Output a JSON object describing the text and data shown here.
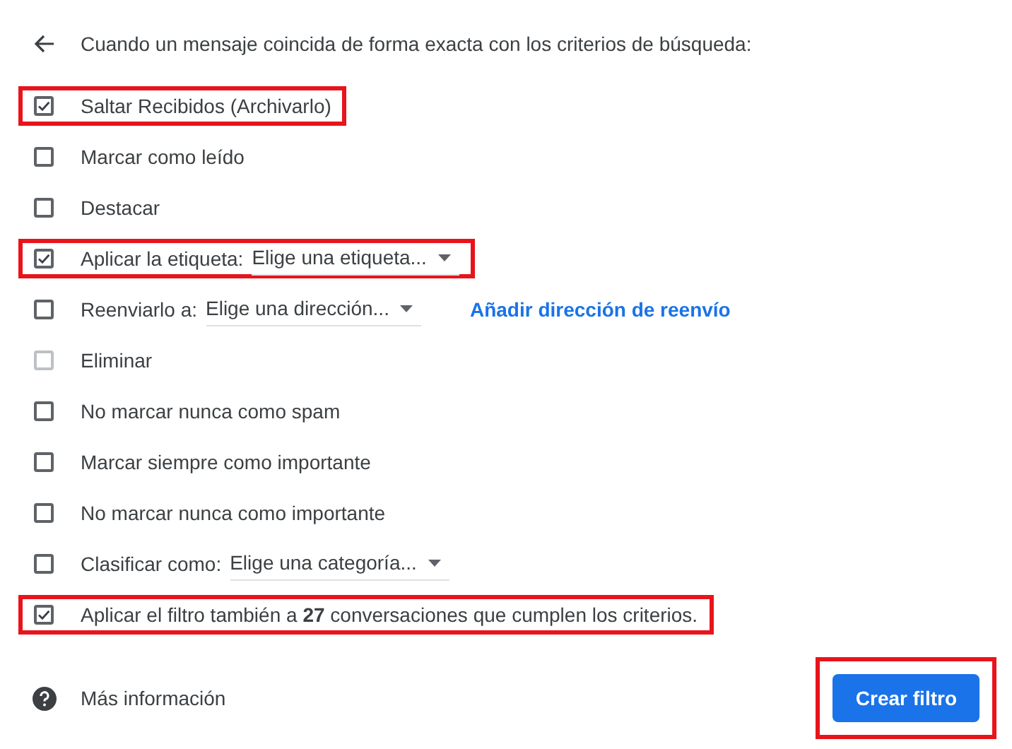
{
  "header": {
    "title": "Cuando un mensaje coincida de forma exacta con los criterios de búsqueda:"
  },
  "options": [
    {
      "kind": "plain",
      "label": "Saltar Recibidos (Archivarlo)",
      "checked": true,
      "disabled": false,
      "highlighted": true
    },
    {
      "kind": "plain",
      "label": "Marcar como leído",
      "checked": false,
      "disabled": false,
      "highlighted": false
    },
    {
      "kind": "plain",
      "label": "Destacar",
      "checked": false,
      "disabled": false,
      "highlighted": false
    },
    {
      "kind": "select",
      "label": "Aplicar la etiqueta:",
      "value": "Elige una etiqueta...",
      "checked": true,
      "disabled": false,
      "highlighted": true
    },
    {
      "kind": "select",
      "label": "Reenviarlo a:",
      "value": "Elige una dirección...",
      "link": "Añadir dirección de reenvío",
      "checked": false,
      "disabled": false,
      "highlighted": false
    },
    {
      "kind": "plain",
      "label": "Eliminar",
      "checked": false,
      "disabled": true,
      "highlighted": false
    },
    {
      "kind": "plain",
      "label": "No marcar nunca como spam",
      "checked": false,
      "disabled": false,
      "highlighted": false
    },
    {
      "kind": "plain",
      "label": "Marcar siempre como importante",
      "checked": false,
      "disabled": false,
      "highlighted": false
    },
    {
      "kind": "plain",
      "label": "No marcar nunca como importante",
      "checked": false,
      "disabled": false,
      "highlighted": false
    },
    {
      "kind": "select",
      "label": "Clasificar como:",
      "value": "Elige una categoría...",
      "checked": false,
      "disabled": false,
      "highlighted": false
    },
    {
      "kind": "rich",
      "label": "Aplicar el filtro también a **27** conversaciones que cumplen los criterios.",
      "checked": true,
      "disabled": false,
      "highlighted": true
    }
  ],
  "footer": {
    "help_link": "Más información",
    "button": {
      "label": "Crear filtro",
      "highlighted": true
    }
  }
}
